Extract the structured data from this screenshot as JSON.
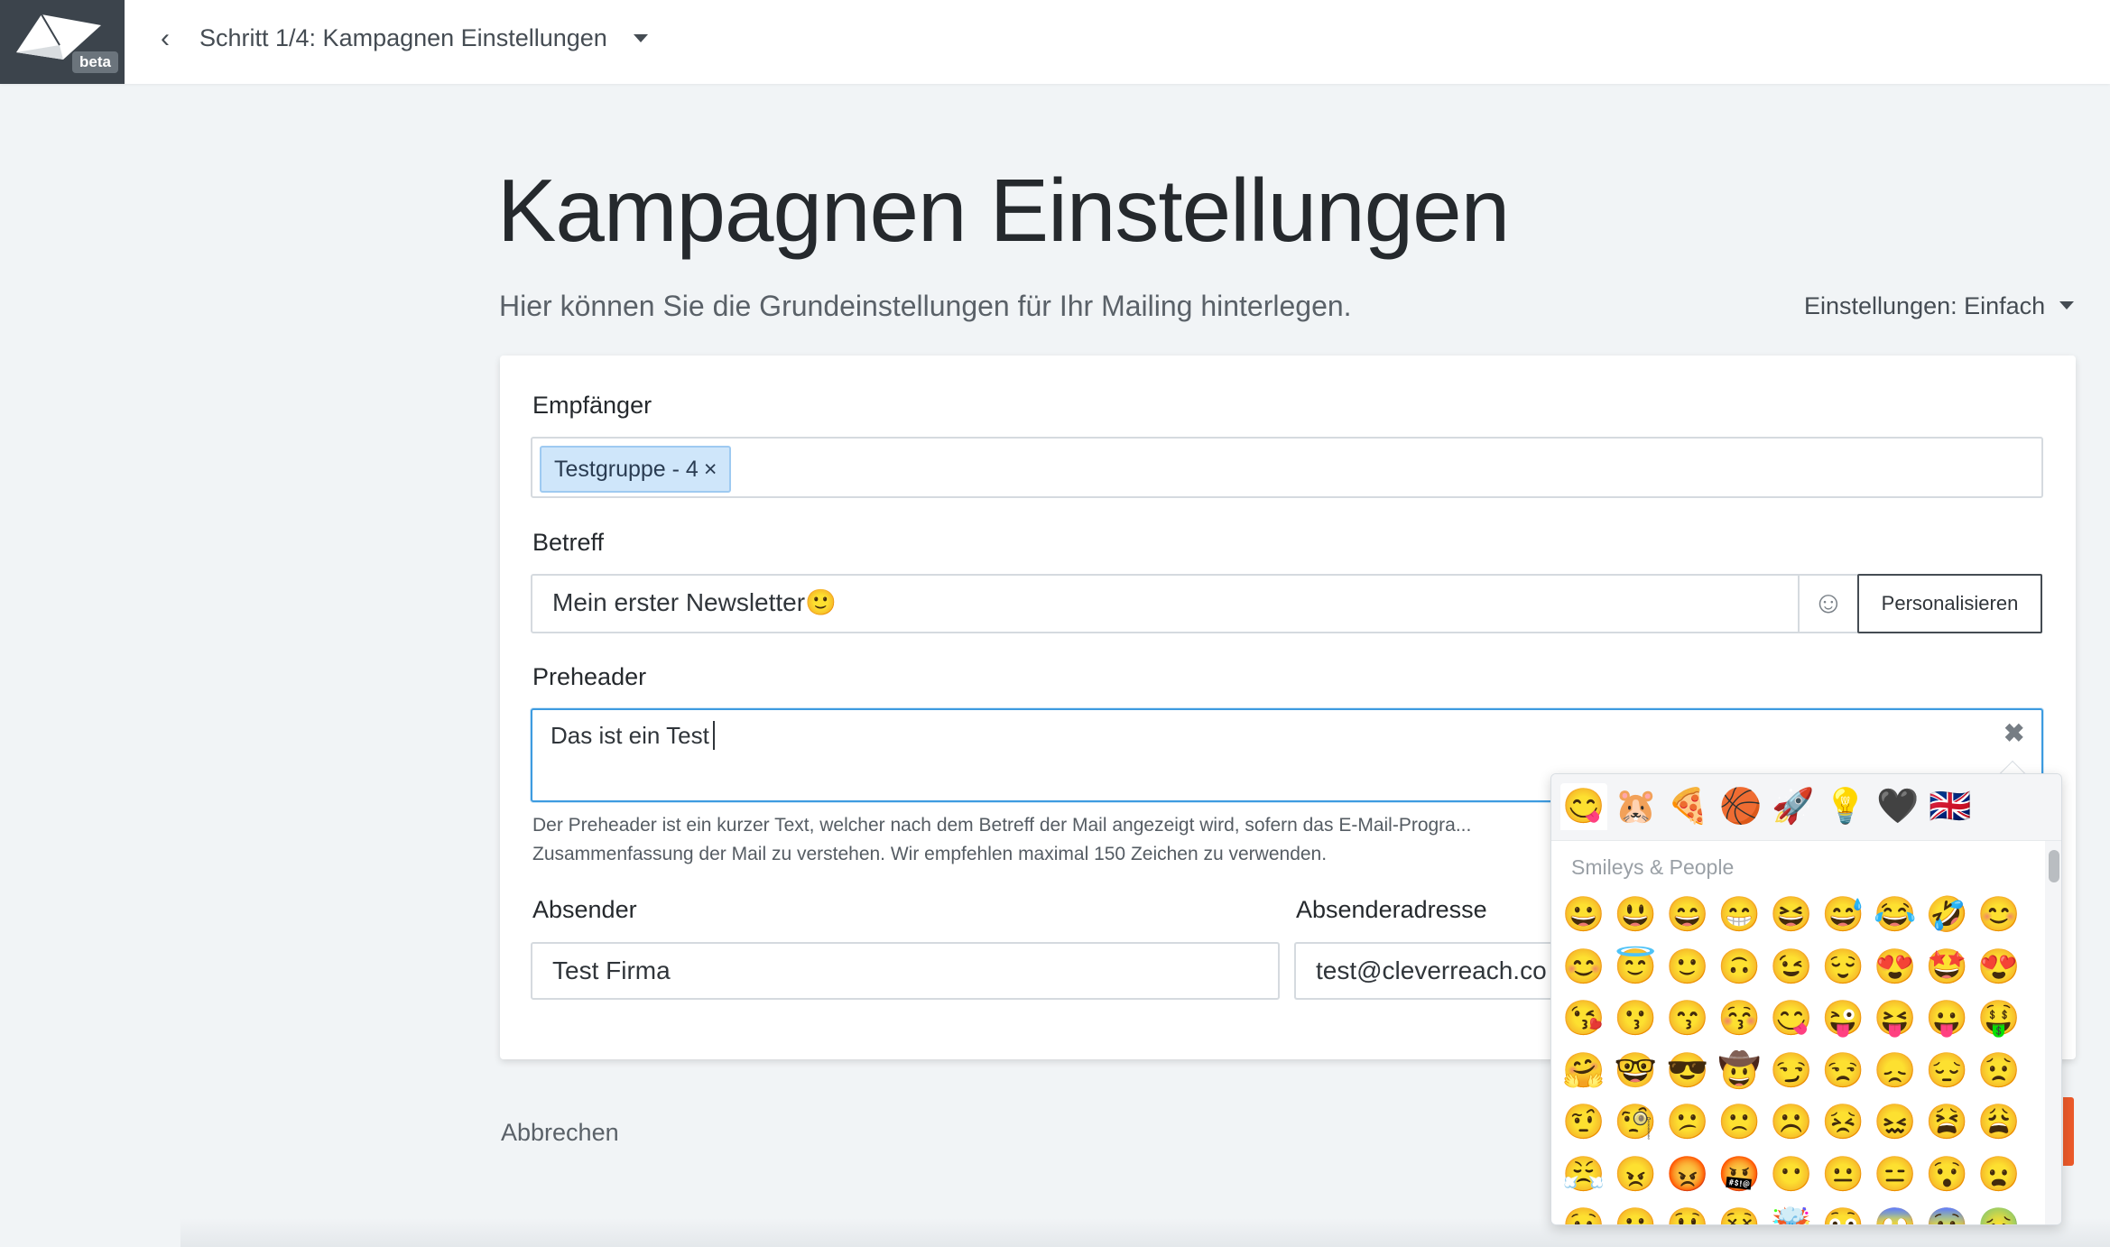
{
  "header": {
    "logo_badge": "beta",
    "back_symbol": "‹",
    "step_title": "Schritt 1/4: Kampagnen Einstellungen"
  },
  "page": {
    "title": "Kampagnen Einstellungen",
    "subtitle": "Hier können Sie die Grundeinstellungen für Ihr Mailing hinterlegen.",
    "settings_toggle": "Einstellungen: Einfach"
  },
  "form": {
    "recipients_label": "Empfänger",
    "recipient_tag": "Testgruppe - 4",
    "recipient_tag_remove": "×",
    "subject_label": "Betreff",
    "subject_value": "Mein erster Newsletter🙂",
    "emoji_button_icon": "☺",
    "personalize_button": "Personalisieren",
    "preheader_label": "Preheader",
    "preheader_value": "Das ist ein Test",
    "clear_icon": "✖",
    "preheader_help": "Der Preheader ist ein kurzer Text, welcher nach dem Betreff der Mail angezeigt wird, sofern das E-Mail-Progra... Zusammenfassung der Mail zu verstehen. Wir empfehlen maximal 150 Zeichen zu verwenden.",
    "sender_label": "Absender",
    "sender_value": "Test Firma",
    "sender_address_label": "Absenderadresse",
    "sender_address_value": "test@cleverreach.co"
  },
  "footer": {
    "cancel_link": "Abbrechen"
  },
  "emoji_picker": {
    "categories": [
      "😋",
      "🐹",
      "🍕",
      "🏀",
      "🚀",
      "💡",
      "🖤",
      "🇬🇧"
    ],
    "section_title": "Smileys & People",
    "rows": [
      [
        "😀",
        "😃",
        "😄",
        "😁",
        "😆",
        "😅",
        "😂",
        "🤣",
        "😊"
      ],
      [
        "😊",
        "😇",
        "🙂",
        "🙃",
        "😉",
        "😌",
        "😍",
        "🤩",
        "😍"
      ],
      [
        "😘",
        "😗",
        "😙",
        "😚",
        "😋",
        "😜",
        "😝",
        "😛",
        "🤑"
      ],
      [
        "🤗",
        "🤓",
        "😎",
        "🤠",
        "😏",
        "😒",
        "😞",
        "😔",
        "😟"
      ],
      [
        "🤨",
        "🧐",
        "😕",
        "🙁",
        "☹️",
        "😣",
        "😖",
        "😫",
        "😩"
      ],
      [
        "😤",
        "😠",
        "😡",
        "🤬",
        "😶",
        "😐",
        "😑",
        "😯",
        "😦"
      ],
      [
        "😧",
        "😮",
        "😲",
        "😵",
        "🤯",
        "😳",
        "😱",
        "😨",
        "🤢"
      ]
    ]
  },
  "colors": {
    "accent": "#3d9be0",
    "tag_bg": "#cfe6fa",
    "next_button": "#ec5a2a",
    "logo_bg": "#3c444c"
  }
}
